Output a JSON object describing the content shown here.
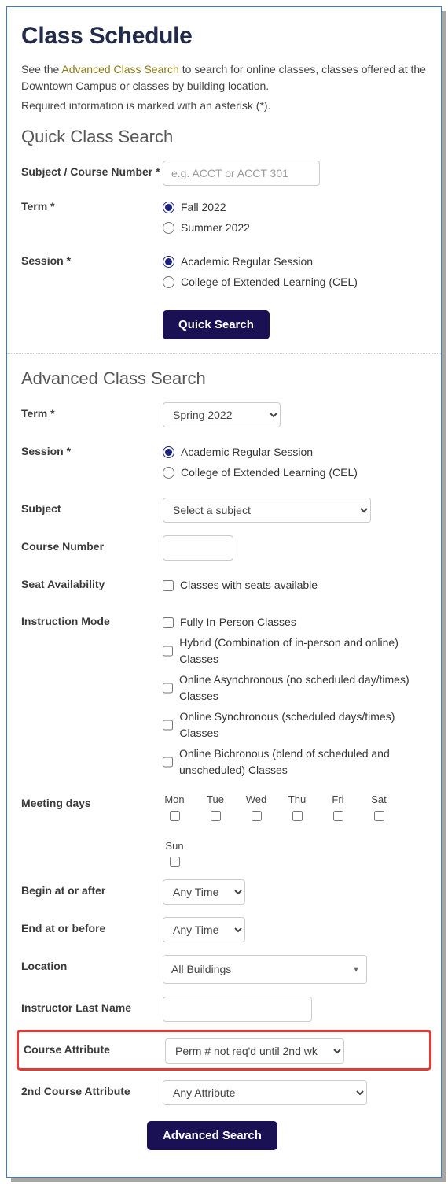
{
  "title": "Class Schedule",
  "intro1a": "See the ",
  "intro1link": "Advanced Class Search",
  "intro1b": " to search for online classes, classes offered at the Downtown Campus or  classes by building location.",
  "intro2": "Required information is marked with an asterisk (*).",
  "quick": {
    "heading": "Quick Class Search",
    "subject_label": "Subject / Course Number *",
    "subject_placeholder": "e.g. ACCT or ACCT 301",
    "term_label": "Term *",
    "term_opts": [
      "Fall 2022",
      "Summer 2022"
    ],
    "session_label": "Session *",
    "session_opts": [
      "Academic Regular Session",
      "College of Extended Learning (CEL)"
    ],
    "button": "Quick Search"
  },
  "adv": {
    "heading": "Advanced Class Search",
    "term_label": "Term *",
    "term_value": "Spring 2022",
    "session_label": "Session *",
    "session_opts": [
      "Academic Regular Session",
      "College of Extended Learning (CEL)"
    ],
    "subject_label": "Subject",
    "subject_value": "Select a subject",
    "course_num_label": "Course Number",
    "seat_label": "Seat Availability",
    "seat_opt": "Classes with seats available",
    "mode_label": "Instruction Mode",
    "mode_opts": [
      "Fully In-Person Classes",
      "Hybrid (Combination of in-person and online) Classes",
      "Online Asynchronous (no scheduled day/times) Classes",
      "Online Synchronous (scheduled days/times) Classes",
      "Online Bichronous (blend of scheduled and unscheduled) Classes"
    ],
    "days_label": "Meeting days",
    "days": [
      "Mon",
      "Tue",
      "Wed",
      "Thu",
      "Fri",
      "Sat",
      "Sun"
    ],
    "begin_label": "Begin at or after",
    "begin_value": "Any Time",
    "end_label": "End at or before",
    "end_value": "Any Time",
    "location_label": "Location",
    "location_value": "All Buildings",
    "instructor_label": "Instructor Last Name",
    "attr_label": "Course Attribute",
    "attr_value": "Perm # not req'd until 2nd wk",
    "attr2_label": "2nd Course Attribute",
    "attr2_value": "Any Attribute",
    "button": "Advanced Search"
  }
}
